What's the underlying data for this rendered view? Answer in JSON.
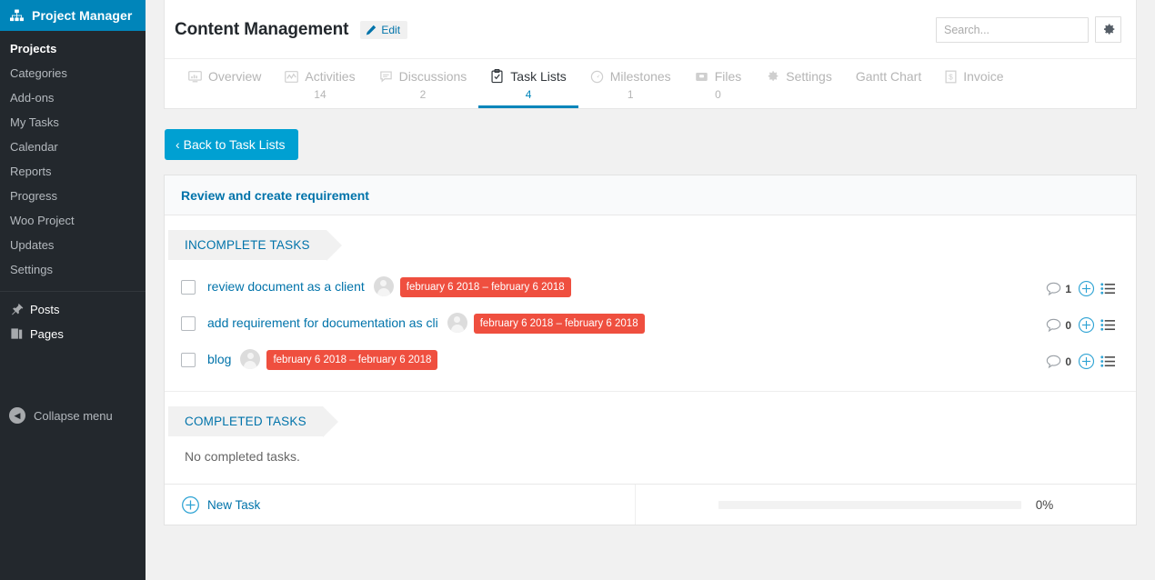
{
  "sidebar": {
    "brand": {
      "label": "Project Manager",
      "icon": "sitemap-icon"
    },
    "items": [
      {
        "label": "Projects",
        "current": true
      },
      {
        "label": "Categories",
        "current": false
      },
      {
        "label": "Add-ons",
        "current": false
      },
      {
        "label": "My Tasks",
        "current": false
      },
      {
        "label": "Calendar",
        "current": false
      },
      {
        "label": "Reports",
        "current": false
      },
      {
        "label": "Progress",
        "current": false
      },
      {
        "label": "Woo Project",
        "current": false
      },
      {
        "label": "Updates",
        "current": false
      },
      {
        "label": "Settings",
        "current": false
      }
    ],
    "main_items": [
      {
        "label": "Posts",
        "icon": "pin-icon"
      },
      {
        "label": "Pages",
        "icon": "pages-icon"
      }
    ],
    "collapse": {
      "label": "Collapse menu",
      "icon": "collapse-arrow-icon"
    }
  },
  "header": {
    "title": "Content Management",
    "edit_label": "Edit",
    "edit_icon": "pencil-icon",
    "search_placeholder": "Search...",
    "search_value": "",
    "gear_icon": "gear-icon"
  },
  "tabs": [
    {
      "label": "Overview",
      "count": "",
      "icon": "monitor-icon",
      "active": false
    },
    {
      "label": "Activities",
      "count": "14",
      "icon": "activity-chart-icon",
      "active": false
    },
    {
      "label": "Discussions",
      "count": "2",
      "icon": "comment-icon",
      "active": false
    },
    {
      "label": "Task Lists",
      "count": "4",
      "icon": "clipboard-check-icon",
      "active": true
    },
    {
      "label": "Milestones",
      "count": "1",
      "icon": "milestone-clock-icon",
      "active": false
    },
    {
      "label": "Files",
      "count": "0",
      "icon": "inbox-icon",
      "active": false
    },
    {
      "label": "Settings",
      "count": "",
      "icon": "gear-icon",
      "active": false
    },
    {
      "label": "Gantt Chart",
      "count": "",
      "icon": "",
      "active": false
    },
    {
      "label": "Invoice",
      "count": "",
      "icon": "invoice-dollar-icon",
      "active": false
    }
  ],
  "back_button": {
    "label": "Back to Task Lists",
    "icon": "chevron-left-icon"
  },
  "task_list": {
    "title": "Review and create requirement",
    "incomplete_heading": "INCOMPLETE TASKS",
    "completed_heading": "COMPLETED TASKS",
    "completed_empty_text": "No completed tasks.",
    "tasks": [
      {
        "name": "review document as a client",
        "date": "february 6 2018 – february 6 2018",
        "comment_count": "1",
        "wrapped": false
      },
      {
        "name": "add requirement for documentation as cli",
        "date": "february 6 2018 – february 6 2018",
        "comment_count": "0",
        "wrapped": true
      },
      {
        "name": "blog",
        "date": "february 6 2018 – february 6 2018",
        "comment_count": "0",
        "wrapped": false
      }
    ]
  },
  "footer": {
    "new_task_label": "New Task",
    "new_task_icon": "plus-circle-icon",
    "progress_percent": "0%",
    "progress_value": 0
  },
  "colors": {
    "brand_blue": "#0085ba",
    "link_blue": "#0073aa",
    "button_blue": "#00a0d2",
    "date_badge_red": "#ef4f3f",
    "sidebar_dark": "#23282d"
  }
}
